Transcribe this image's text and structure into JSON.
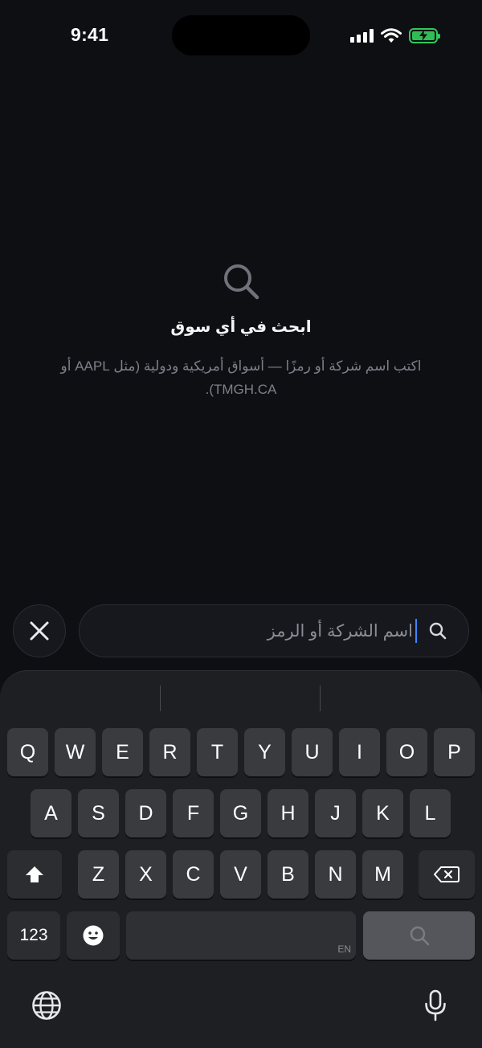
{
  "status_bar": {
    "time": "9:41"
  },
  "empty_state": {
    "title": "ابحث في أي سوق",
    "subtitle": "اكتب اسم شركة أو رمزًا — أسواق أمريكية ودولية (مثل AAPL أو TMGH.CA)."
  },
  "search": {
    "placeholder": "اسم الشركة أو الرمز"
  },
  "keyboard": {
    "row1": [
      "Q",
      "W",
      "E",
      "R",
      "T",
      "Y",
      "U",
      "I",
      "O",
      "P"
    ],
    "row2": [
      "A",
      "S",
      "D",
      "F",
      "G",
      "H",
      "J",
      "K",
      "L"
    ],
    "row3": [
      "Z",
      "X",
      "C",
      "V",
      "B",
      "N",
      "M"
    ],
    "numbers_label": "123",
    "space_lang": "EN"
  },
  "icons": {
    "search": "search-icon",
    "close": "close-icon",
    "shift": "shift-icon",
    "delete": "delete-icon",
    "emoji": "emoji-icon",
    "globe": "globe-icon",
    "mic": "microphone-icon"
  },
  "colors": {
    "background": "#0e0f13",
    "caret": "#3a86ff",
    "battery": "#34c759"
  }
}
